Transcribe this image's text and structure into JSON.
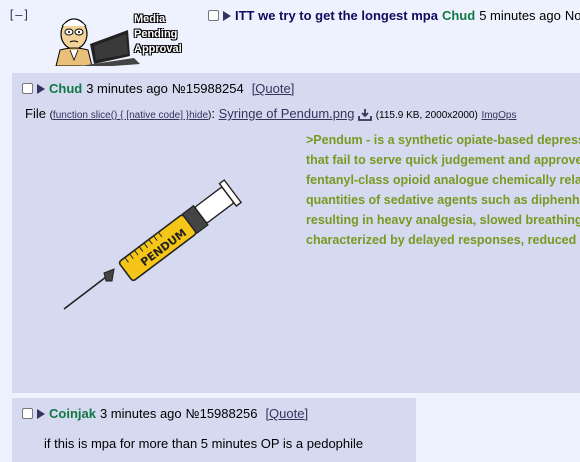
{
  "thread_toggle": "[–]",
  "pending_image": {
    "lines": [
      "Media",
      "Pending",
      "Approval"
    ]
  },
  "op": {
    "subject": "ITT we try to get the longest mpa",
    "name": "Chud",
    "time": "5 minutes ago",
    "number_prefix": "No"
  },
  "reply1": {
    "name": "Chud",
    "time": "3 minutes ago",
    "number": "№15988254",
    "quote_label": "[Quote]",
    "file_label": "File",
    "hide_label": "(hide)",
    "file_name": "Syringe of Pendum.png",
    "file_info": "(115.9 KB, 2000x2000)",
    "imgops": "ImgOps",
    "syringe_text": "PENDUM",
    "greentext": [
      ">Pendum - is a synthetic opiate-based depress",
      "that fail to serve quick judgement and approve",
      "fentanyl-class opioid analogue chemically relat",
      "quantities of sedative agents such as diphenhy",
      "resulting in heavy analgesia, slowed breathing,",
      "characterized by delayed responses, reduced i"
    ]
  },
  "reply2": {
    "name": "Coinjak",
    "time": "3 minutes ago",
    "number": "№15988256",
    "quote_label": "[Quote]",
    "comment": "if this is mpa for more than 5 minutes OP is a pedophile"
  },
  "colors": {
    "background": "#eef2ff",
    "reply_background": "#d6daf0",
    "name": "#117743",
    "subject": "#0f0c5d",
    "greentext": "#789922",
    "link": "#34345c"
  }
}
